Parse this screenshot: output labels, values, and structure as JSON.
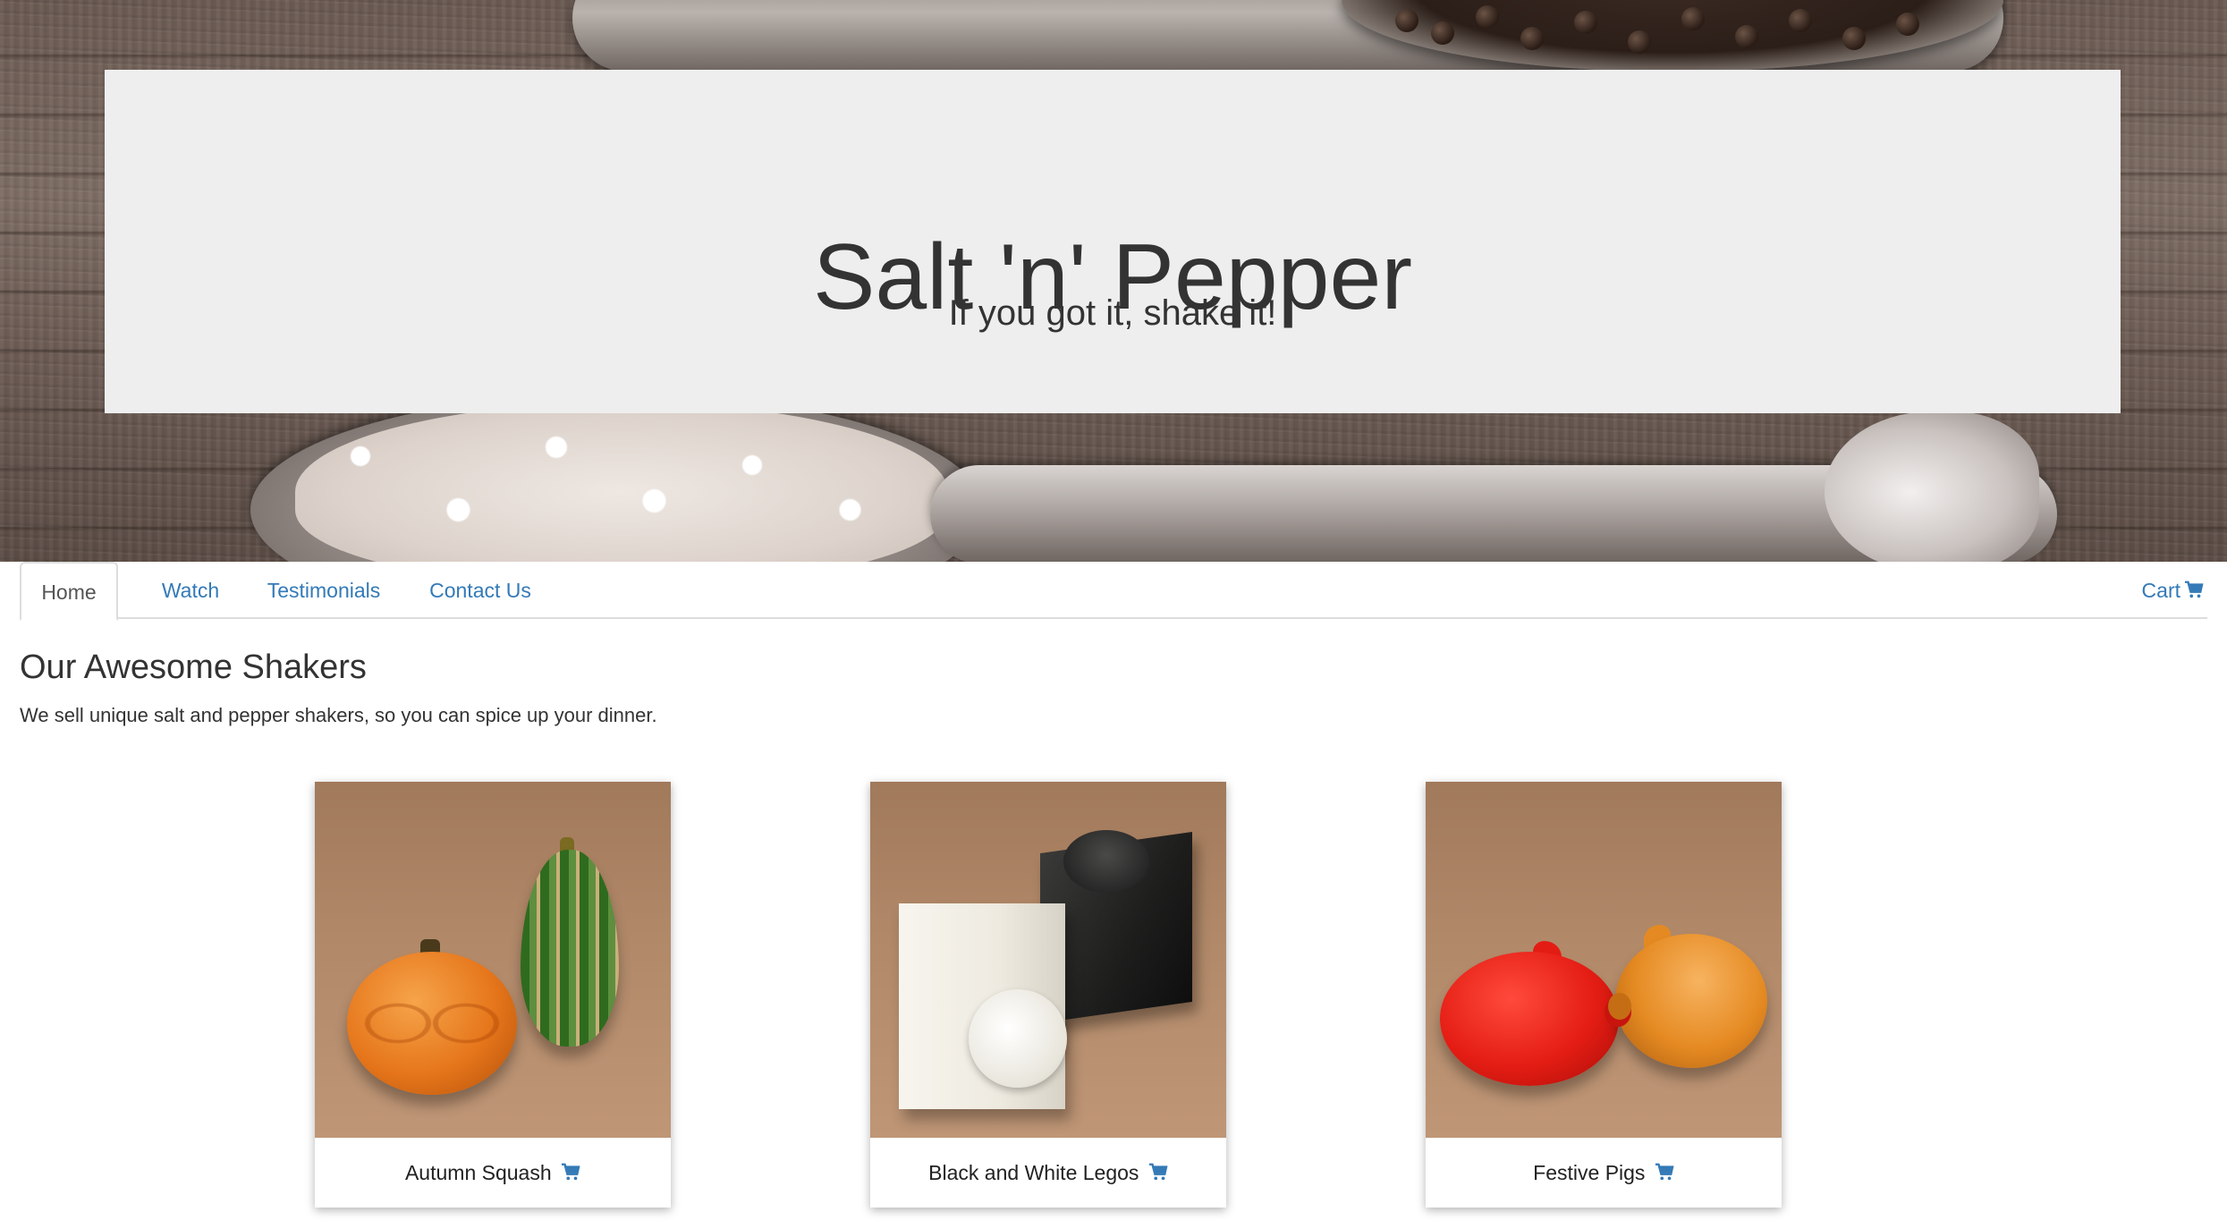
{
  "hero": {
    "title": "Salt 'n' Pepper",
    "tagline": "If you got it, shake it!"
  },
  "nav": {
    "tabs": [
      {
        "label": "Home",
        "active": true
      },
      {
        "label": "Watch",
        "active": false
      },
      {
        "label": "Testimonials",
        "active": false
      },
      {
        "label": "Contact Us",
        "active": false
      }
    ],
    "cart_label": "Cart"
  },
  "main": {
    "title": "Our Awesome Shakers",
    "description": "We sell unique salt and pepper shakers, so you can spice up your dinner."
  },
  "products": [
    {
      "name": "Autumn Squash",
      "icon": "cart-icon"
    },
    {
      "name": "Black and White Legos",
      "icon": "cart-icon"
    },
    {
      "name": "Festive Pigs",
      "icon": "cart-icon"
    }
  ],
  "colors": {
    "link": "#337ab7",
    "jumbotron_bg": "#eeeeee",
    "text": "#333333"
  }
}
